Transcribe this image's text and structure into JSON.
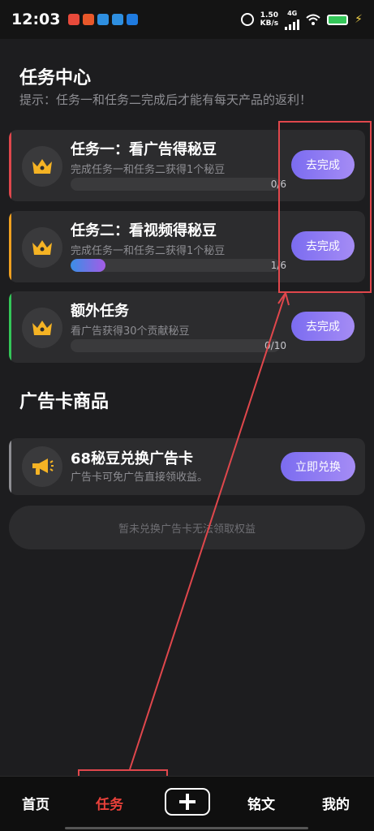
{
  "status": {
    "time": "12:03",
    "speed_value": "1.50",
    "speed_unit": "KB/s",
    "network": "4G",
    "app_icon_colors": [
      "#e84a3b",
      "#e8582a",
      "#2e8fe0",
      "#2e8fe0",
      "#1f7be0"
    ]
  },
  "task_center": {
    "title": "任务中心",
    "hint": "提示：任务一和任务二完成后才能有每天产品的返利！"
  },
  "tasks": [
    {
      "title": "任务一：看广告得秘豆",
      "desc": "完成任务一和任务二获得1个秘豆",
      "progress_text": "0/6",
      "progress": 0,
      "button": "去完成",
      "accent": "#e0474c",
      "icon": "crown-icon"
    },
    {
      "title": "任务二：看视频得秘豆",
      "desc": "完成任务一和任务二获得1个秘豆",
      "progress_text": "1/6",
      "progress": 0.1667,
      "button": "去完成",
      "accent": "#f0a020",
      "icon": "crown-icon"
    },
    {
      "title": "额外任务",
      "desc": "看广告获得30个贡献秘豆",
      "progress_text": "0/10",
      "progress": 0,
      "button": "去完成",
      "accent": "#34c759",
      "icon": "crown-icon"
    }
  ],
  "ad_card_section": {
    "title": "广告卡商品",
    "product": {
      "title": "68秘豆兑换广告卡",
      "desc": "广告卡可免广告直接领收益。",
      "button": "立即兑换",
      "icon": "megaphone-icon"
    },
    "notice": "暂未兑换广告卡无法领取权益"
  },
  "tabbar": {
    "items": [
      {
        "label": "首页",
        "active": false
      },
      {
        "label": "任务",
        "active": true
      },
      {
        "label": "铭文",
        "active": false
      },
      {
        "label": "我的",
        "active": false
      }
    ],
    "plus_icon": "plus-icon"
  },
  "colors": {
    "background": "#1d1d1f",
    "card": "#2c2c2e",
    "button_gradient_start": "#7b6cf0",
    "button_gradient_end": "#a58cf5",
    "crown": "#f5b324",
    "active_tab": "#e8403a",
    "annotation": "#e0474c"
  }
}
